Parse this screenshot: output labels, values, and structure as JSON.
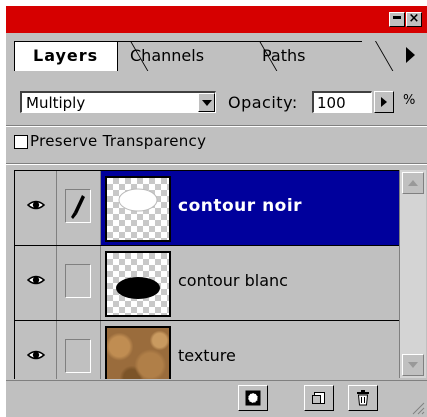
{
  "tabs": [
    {
      "label": "Layers",
      "active": true
    },
    {
      "label": "Channels",
      "active": false
    },
    {
      "label": "Paths",
      "active": false
    }
  ],
  "blend_mode": {
    "value": "Multiply"
  },
  "opacity": {
    "label": "Opacity:",
    "value": "100",
    "unit": "%"
  },
  "preserve_transparency": {
    "label": "Preserve Transparency",
    "checked": false
  },
  "layers": [
    {
      "name": "contour noir",
      "selected": true,
      "visible": true,
      "brush": true
    },
    {
      "name": "contour blanc",
      "selected": false,
      "visible": true,
      "brush": false
    },
    {
      "name": "texture",
      "selected": false,
      "visible": true,
      "brush": false
    }
  ],
  "colors": {
    "title_bar": "#d60000",
    "selection": "#00009c",
    "panel": "#c0c0c0"
  },
  "icons": [
    "close-icon",
    "minimize-icon",
    "panel-menu-arrow-icon",
    "eye-icon",
    "paintbrush-icon",
    "layer-mask-icon",
    "new-layer-icon",
    "trash-icon"
  ]
}
